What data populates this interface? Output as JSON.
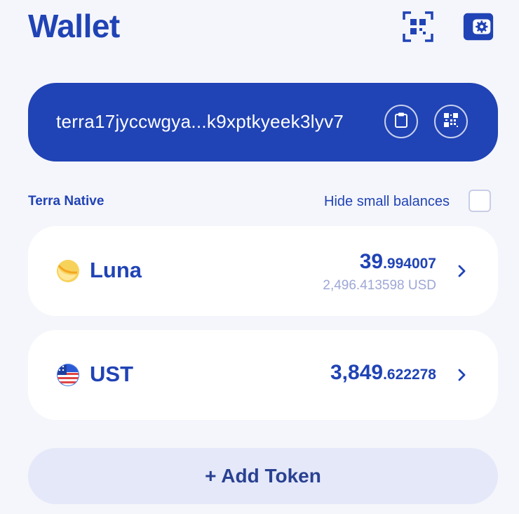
{
  "header": {
    "title": "Wallet",
    "qr_scan_icon": "qr-scan-icon",
    "settings_icon": "wallet-settings-icon"
  },
  "address_card": {
    "address": "terra17jyccwgya...k9xptkyeek3lyv7",
    "copy_icon": "clipboard-icon",
    "qr_icon": "qr-code-icon"
  },
  "balances": {
    "section_title": "Terra Native",
    "hide_small_label": "Hide small balances",
    "hide_small_checked": false,
    "tokens": [
      {
        "name": "Luna",
        "amount_int": "39",
        "amount_dec": ".994007",
        "usd": "2,496.413598 USD",
        "icon": "luna-icon"
      },
      {
        "name": "UST",
        "amount_int": "3,849",
        "amount_dec": ".622278",
        "usd": "",
        "icon": "us-flag-globe-icon"
      }
    ]
  },
  "add_token": {
    "label": "+ Add Token"
  },
  "colors": {
    "brand": "#2043b5",
    "background": "#f5f6fb",
    "card": "#ffffff",
    "muted": "#9ea7d6",
    "button_bg": "#e4e8f9"
  }
}
